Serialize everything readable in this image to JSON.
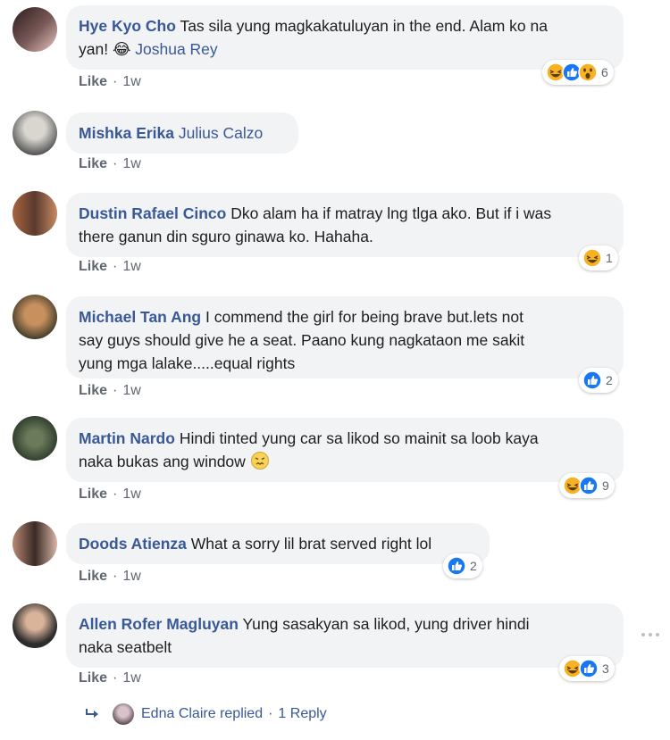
{
  "comments": [
    {
      "author": "Hye Kyo Cho",
      "text_1": "Tas sila yung magkakatuluyan in the end. Alam ko na",
      "text_2": "yan! 😂 ",
      "mention": "Joshua Rey",
      "like": "Like",
      "time": "1w",
      "reaction_count": "6",
      "reactions": [
        "haha",
        "like",
        "wow"
      ]
    },
    {
      "author": "Mishka Erika",
      "mention": "Julius Calzo",
      "like": "Like",
      "time": "1w"
    },
    {
      "author": "Dustin Rafael Cinco",
      "text_1": "Dko alam ha if matray lng tlga ako. But if i was",
      "text_2": "there ganun din sguro ginawa ko. Hahaha.",
      "like": "Like",
      "time": "1w",
      "reaction_count": "1",
      "reactions": [
        "haha"
      ]
    },
    {
      "author": "Michael Tan Ang",
      "text_1": "I commend the girl for being brave but.lets not",
      "text_2": "say guys should give he a seat. Paano kung nagkataon me sakit",
      "text_3": "yung mga lalake.....equal rights",
      "like": "Like",
      "time": "1w",
      "reaction_count": "2",
      "reactions": [
        "like"
      ]
    },
    {
      "author": "Martin Nardo",
      "text_1": "Hindi tinted yung car sa likod so mainit sa loob kaya",
      "text_2": "naka bukas ang window",
      "like": "Like",
      "time": "1w",
      "reaction_count": "9",
      "reactions": [
        "haha",
        "like"
      ]
    },
    {
      "author": "Doods Atienza",
      "text_1": "What a sorry lil brat served right lol",
      "like": "Like",
      "time": "1w",
      "reaction_count": "2",
      "reactions": [
        "like"
      ]
    },
    {
      "author": "Allen Rofer Magluyan",
      "text_1": "Yung sasakyan sa likod, yung driver hindi",
      "text_2": "naka seatbelt",
      "like": "Like",
      "time": "1w",
      "reaction_count": "3",
      "reactions": [
        "haha",
        "like"
      ]
    }
  ],
  "reply": {
    "name": "Edna Claire",
    "replied": "replied",
    "sep": "·",
    "count": "1 Reply"
  },
  "separator": "·",
  "colors": {
    "link": "#385898",
    "bubble": "#f2f3f5",
    "meta": "#606770",
    "like_blue": "#1877f2",
    "haha_yellow": "#f7b125"
  }
}
